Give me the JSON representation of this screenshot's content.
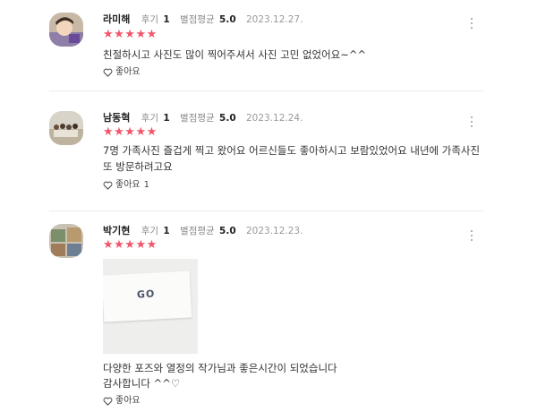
{
  "reviews": [
    {
      "name": "라미해",
      "review_label": "후기",
      "review_count": "1",
      "rating_label": "별점평균",
      "rating_avg": "5.0",
      "date": "2023.12.27.",
      "stars": "★★★★★",
      "text": "친절하시고 사진도 많이 찍어주셔서 사진 고민 없었어요~^^",
      "like_label": "좋아요",
      "like_count": ""
    },
    {
      "name": "남동혁",
      "review_label": "후기",
      "review_count": "1",
      "rating_label": "별점평균",
      "rating_avg": "5.0",
      "date": "2023.12.24.",
      "stars": "★★★★★",
      "text": "7명 가족사진 즐겁게 찍고 왔어요 어르신들도 좋아하시고 보람있었어요 내년에 가족사진 또 방문하려고요",
      "like_label": "좋아요",
      "like_count": "1"
    },
    {
      "name": "박기현",
      "review_label": "후기",
      "review_count": "1",
      "rating_label": "별점평균",
      "rating_avg": "5.0",
      "date": "2023.12.23.",
      "stars": "★★★★★",
      "text_line1": "다양한 포즈와 열정의 작가님과 좋은시간이 되었습니다",
      "text_line2": "감사합니다 ^^♡",
      "photo_logo": "GO",
      "photo_caption": "",
      "like_label": "좋아요",
      "like_count": ""
    }
  ],
  "colors": {
    "star": "#f0556a",
    "divider": "#ececec"
  },
  "icons": {
    "like": "heart-outline-icon",
    "more": "more-vertical-icon"
  }
}
